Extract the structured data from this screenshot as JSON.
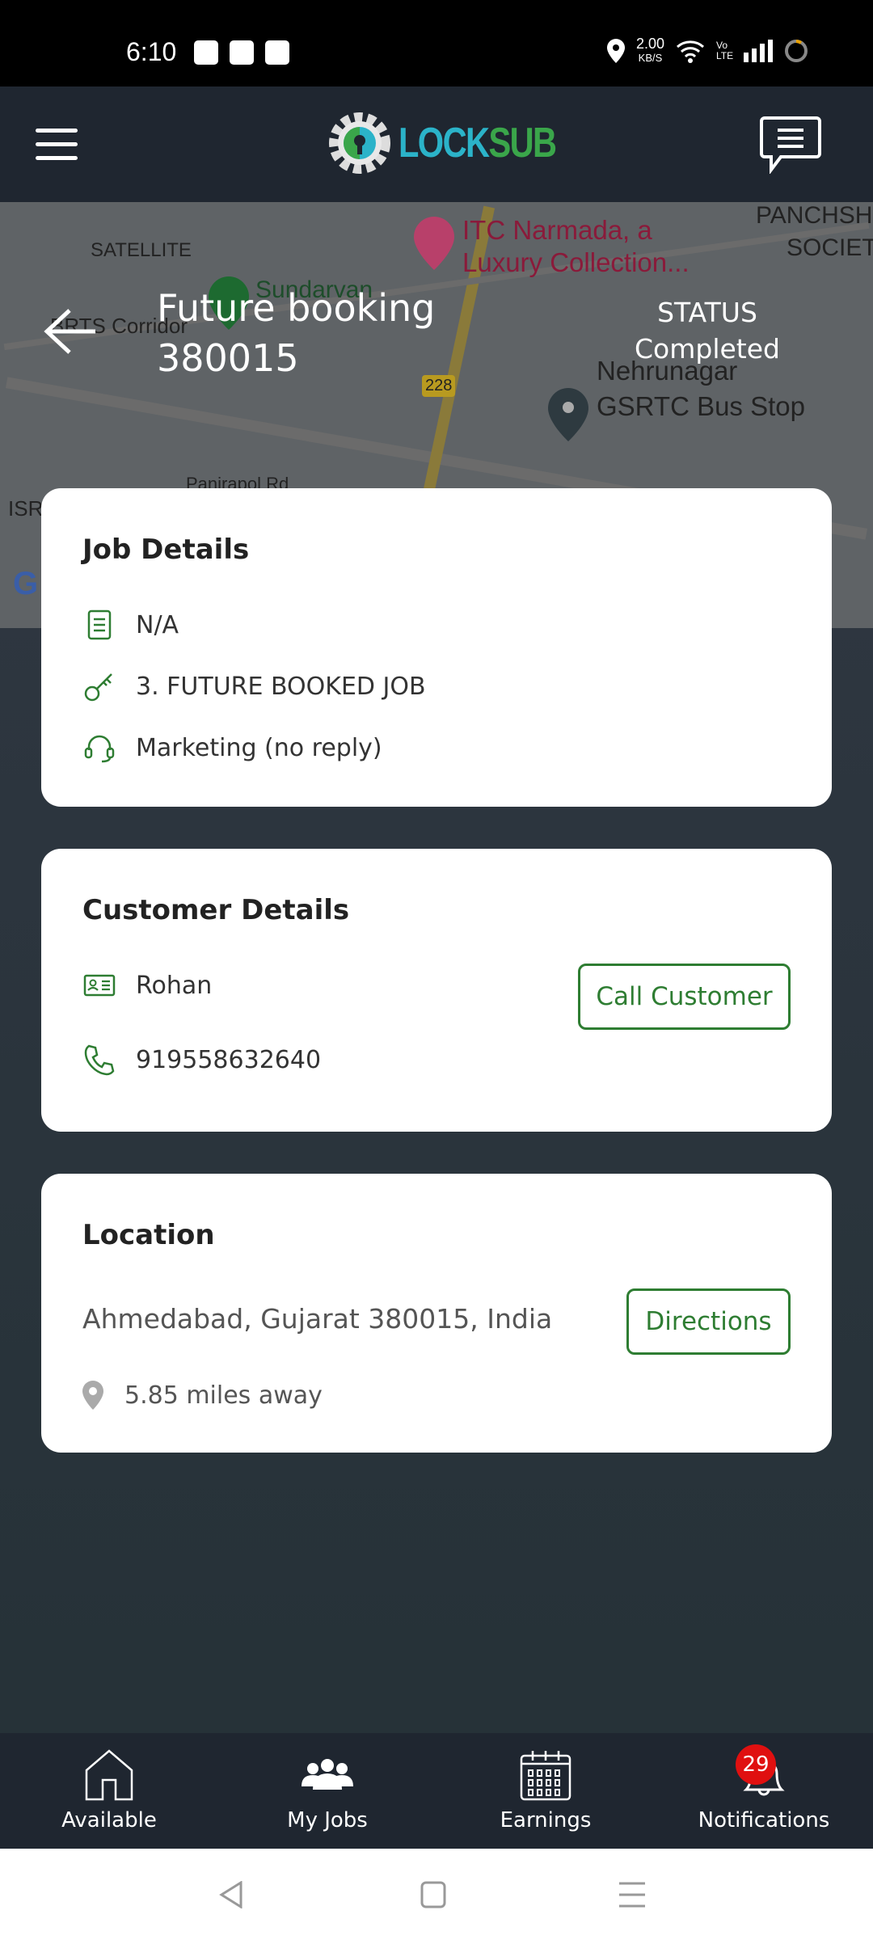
{
  "status_bar": {
    "time": "6:10",
    "net_speed": "2.00",
    "net_unit": "KB/S",
    "volte": "Vo LTE"
  },
  "header": {
    "logo_text_a": "LOCK",
    "logo_text_b": "SUB",
    "colors": {
      "logo_blue": "#2bb3c9",
      "logo_green": "#3aa64a"
    }
  },
  "map": {
    "labels": [
      "SATELLITE",
      "ITC Narmada, a",
      "Luxury Collection...",
      "PANCHSH",
      "SOCIET",
      "Sundarvan",
      "BRTS Corridor",
      "228",
      "Nehrunagar",
      "GSRTC Bus Stop",
      "ISR",
      "Panjrapol Rd"
    ]
  },
  "job": {
    "title_line1": "Future booking",
    "title_line2": "380015",
    "status_label": "STATUS",
    "status_value": "Completed"
  },
  "job_details": {
    "title": "Job Details",
    "items": [
      "N/A",
      "3. FUTURE BOOKED JOB",
      "Marketing (no reply)"
    ]
  },
  "customer": {
    "title": "Customer Details",
    "name": "Rohan",
    "phone": "919558632640",
    "call_button": "Call Customer"
  },
  "location": {
    "title": "Location",
    "address": "Ahmedabad, Gujarat 380015, India",
    "distance": "5.85 miles away",
    "directions_button": "Directions"
  },
  "bottom_nav": {
    "items": [
      {
        "label": "Available"
      },
      {
        "label": "My Jobs"
      },
      {
        "label": "Earnings"
      },
      {
        "label": "Notifications",
        "badge": "29"
      }
    ],
    "active": "My Jobs"
  },
  "accent": "#2e7d32"
}
